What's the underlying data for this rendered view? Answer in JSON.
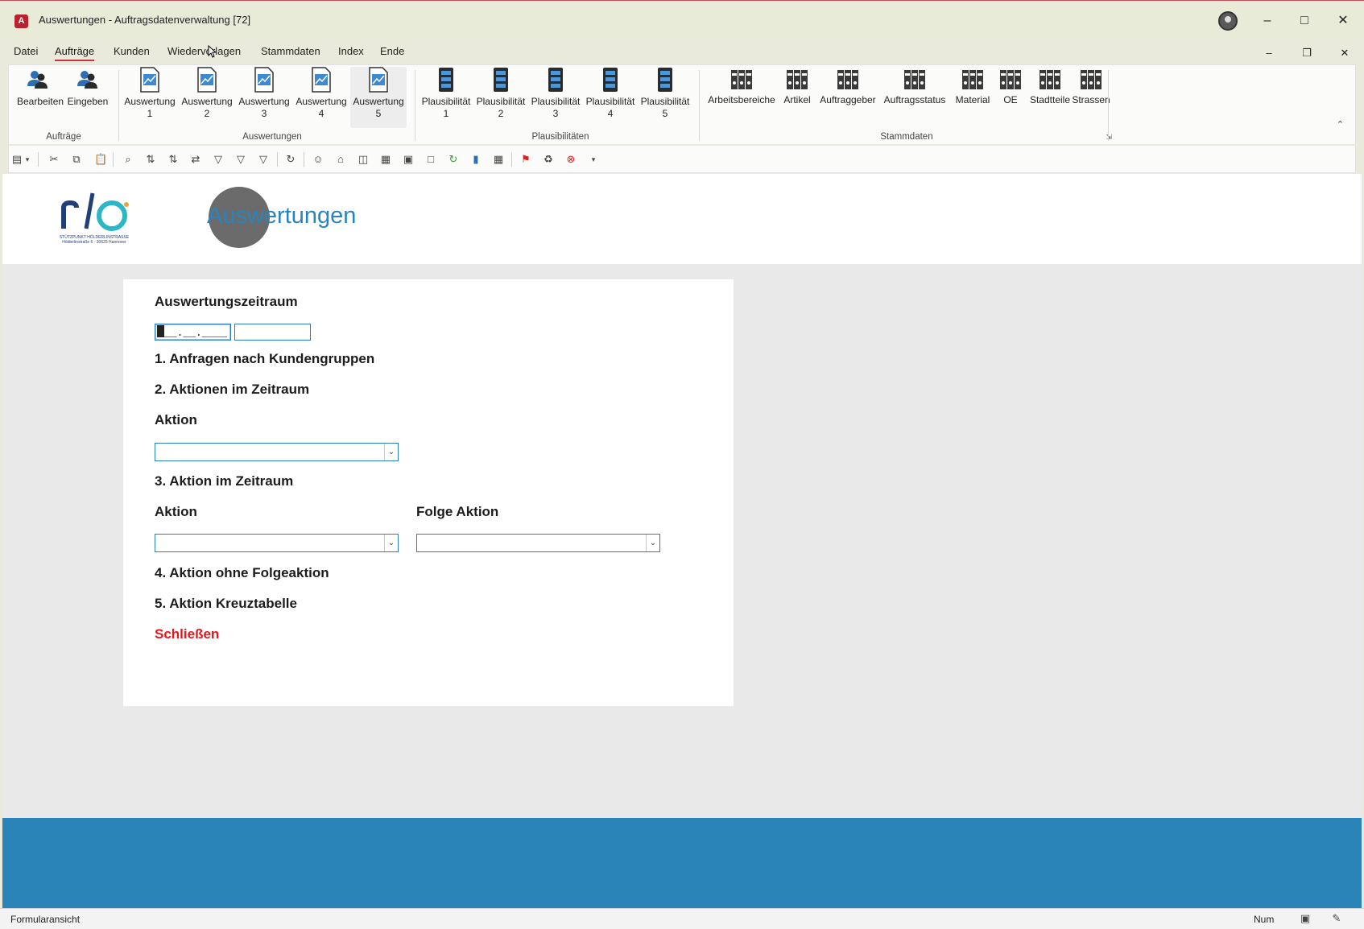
{
  "window": {
    "title": "Auswertungen  -  Auftragsdatenverwaltung [72]",
    "app_icon_letter": "A"
  },
  "menu": {
    "items": [
      "Datei",
      "Aufträge",
      "Kunden",
      "Wiedervorlagen",
      "Stammdaten",
      "Index",
      "Ende"
    ],
    "active": "Aufträge"
  },
  "ribbon": {
    "groups": {
      "auftraege": {
        "label": "Aufträge",
        "buttons": [
          "Bearbeiten",
          "Eingeben"
        ]
      },
      "auswertungen": {
        "label": "Auswertungen",
        "buttons": [
          {
            "line1": "Auswertung",
            "line2": "1"
          },
          {
            "line1": "Auswertung",
            "line2": "2"
          },
          {
            "line1": "Auswertung",
            "line2": "3"
          },
          {
            "line1": "Auswertung",
            "line2": "4"
          },
          {
            "line1": "Auswertung",
            "line2": "5"
          }
        ]
      },
      "plausibilitaeten": {
        "label": "Plausibilitäten",
        "buttons": [
          {
            "line1": "Plausibilität",
            "line2": "1"
          },
          {
            "line1": "Plausibilität",
            "line2": "2"
          },
          {
            "line1": "Plausibilität",
            "line2": "3"
          },
          {
            "line1": "Plausibilität",
            "line2": "4"
          },
          {
            "line1": "Plausibilität",
            "line2": "5"
          }
        ]
      },
      "stammdaten": {
        "label": "Stammdaten",
        "buttons": [
          "Arbeitsbereiche",
          "Artikel",
          "Auftraggeber",
          "Auftragsstatus",
          "Material",
          "OE",
          "Stadtteile",
          "Strassen"
        ]
      }
    }
  },
  "form": {
    "header_title": "Auswertungen",
    "logo_text": "STÜTZPUNKT HÖLDERLINSTRASSE Hölderlinstraße 6 · 30625 Hannover",
    "period_label": "Auswertungszeitraum",
    "date_from_value": "__.__.____",
    "date_to_value": "",
    "item1": "1. Anfragen nach Kundengruppen",
    "item2": "2. Aktionen im Zeitraum",
    "aktion_label": "Aktion",
    "item3": "3. Aktion im Zeitraum",
    "aktion_label_2": "Aktion",
    "folge_aktion_label": "Folge Aktion",
    "item4": "4. Aktion ohne Folgeaktion",
    "item5": "5. Aktion Kreuztabelle",
    "close": "Schließen",
    "colors": {
      "header_title": "#2a83bd",
      "close": "#e8151b",
      "footer": "#2b84b7"
    }
  },
  "status": {
    "view": "Formularansicht",
    "num": "Num"
  }
}
